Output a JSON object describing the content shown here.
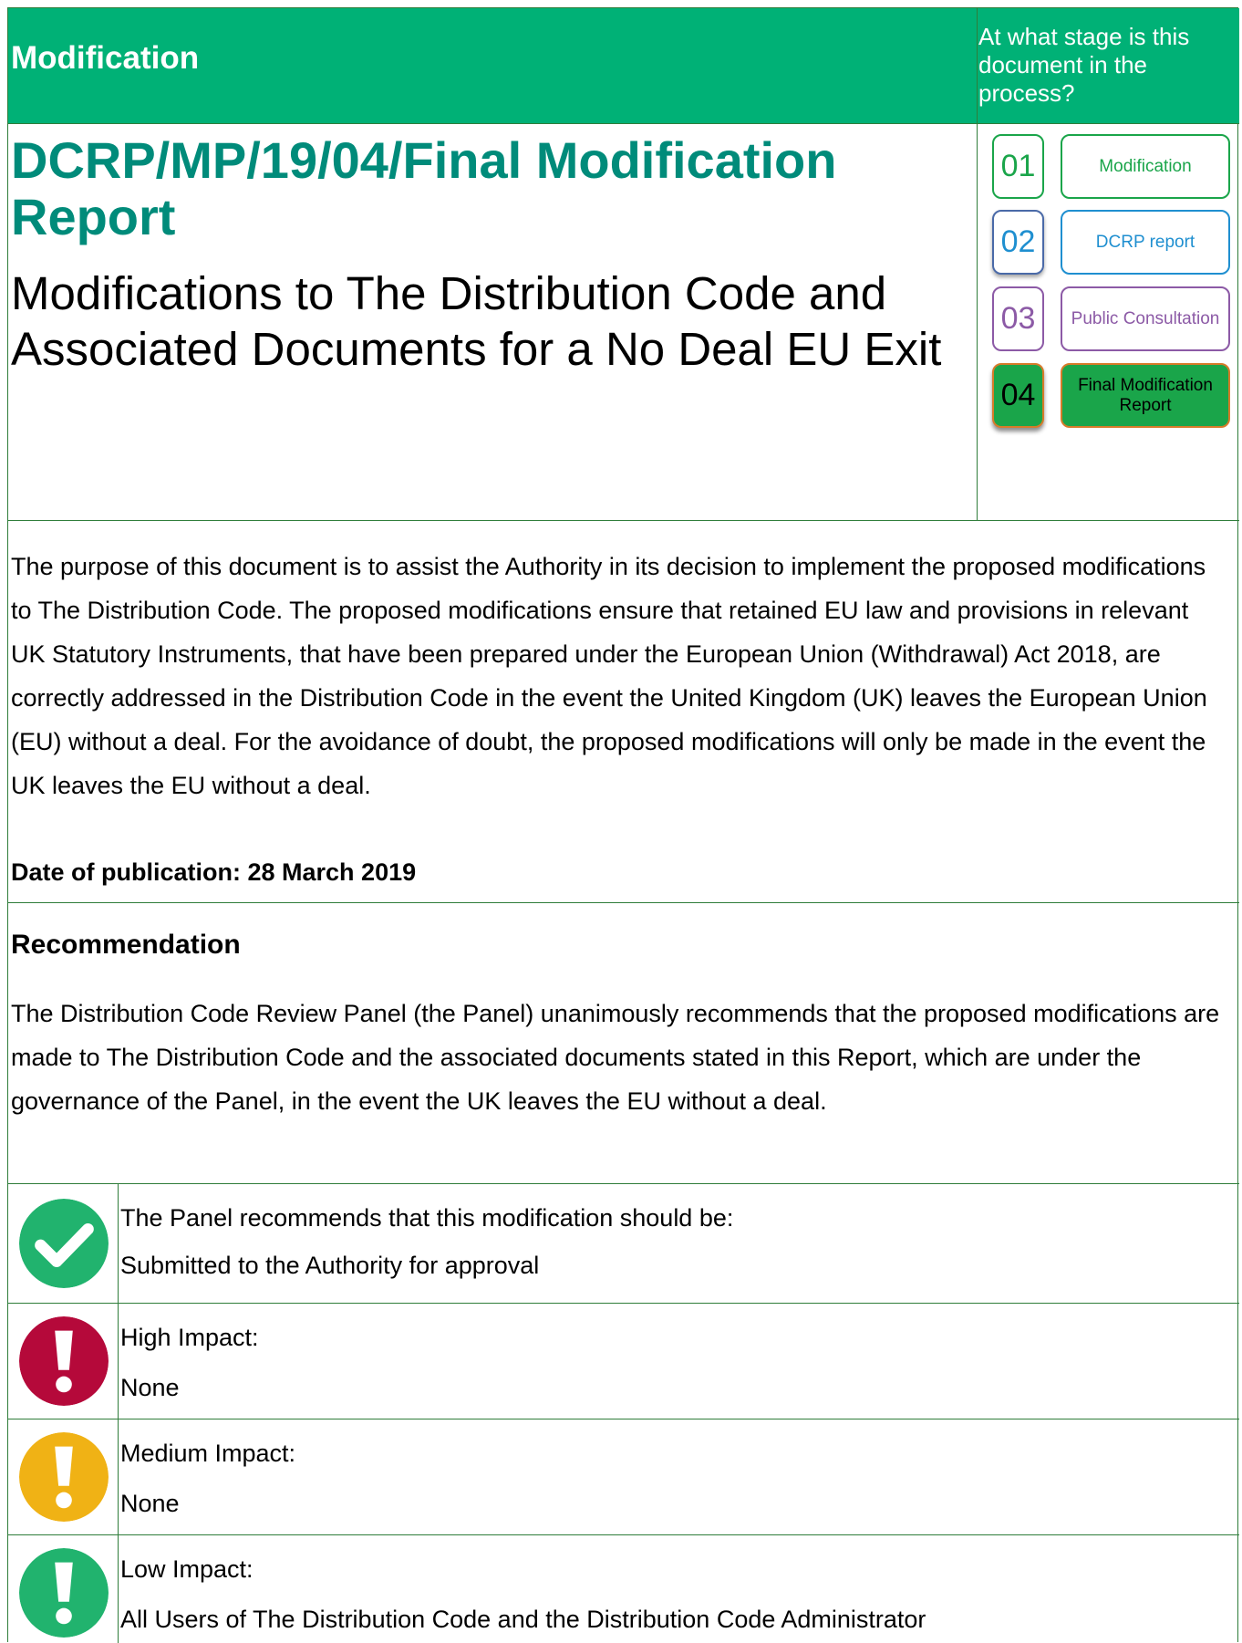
{
  "header": {
    "label": "Modification",
    "stage_question": "At what stage is this document in the process?"
  },
  "title": "DCRP/MP/19/04/Final Modification Report",
  "subtitle": "Modifications to The Distribution Code and Associated Documents for a No Deal EU Exit",
  "stages": [
    {
      "number": "01",
      "label": "Modification",
      "color": "#1aa54a"
    },
    {
      "number": "02",
      "label": "DCRP report",
      "color": "#1f8fd0"
    },
    {
      "number": "03",
      "label": "Public Consultation",
      "color": "#8c5aa6"
    },
    {
      "number": "04",
      "label": "Final Modification Report",
      "color": "#1aa54a",
      "active": true
    }
  ],
  "purpose": "The purpose of this document is to assist the Authority in its decision to implement the proposed modifications to The Distribution Code. The proposed modifications ensure that retained EU law and provisions in relevant UK Statutory Instruments, that have been prepared under the European Union (Withdrawal) Act 2018, are correctly addressed in the Distribution Code in the event the United Kingdom (UK) leaves the European Union (EU) without a deal. For the avoidance of doubt, the proposed modifications will only be made in the event the UK leaves the EU without a deal.",
  "publication_date": "Date of publication: 28 March 2019",
  "recommendation": {
    "heading": "Recommendation",
    "text": "The Distribution Code Review Panel (the Panel) unanimously recommends that the proposed modifications are made to The Distribution Code and the associated documents stated in this Report, which are under the governance of the Panel, in the event the UK leaves the EU without a deal."
  },
  "rows": [
    {
      "icon": "check-circle-icon",
      "color": "#21b36e",
      "line1": "The Panel recommends that this modification should be:",
      "line2": "Submitted to the Authority for approval"
    },
    {
      "icon": "exclamation-circle-icon",
      "color": "#b5093a",
      "line1": "High Impact:",
      "line2": "None"
    },
    {
      "icon": "exclamation-circle-icon",
      "color": "#f0b215",
      "line1": "Medium Impact:",
      "line2": "None"
    },
    {
      "icon": "exclamation-circle-icon",
      "color": "#21b36e",
      "line1": "Low Impact:",
      "line2": "All Users of The Distribution Code and the Distribution Code Administrator"
    }
  ]
}
